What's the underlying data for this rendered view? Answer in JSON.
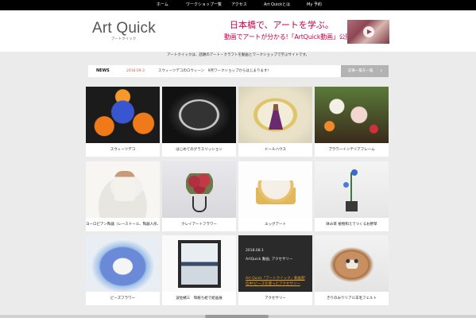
{
  "nav": {
    "items": [
      "ホーム",
      "ワークショップ一覧",
      "アクセス",
      "Art Quickとは",
      "My 予約"
    ]
  },
  "logo": {
    "title": "Art Quick",
    "subtitle": "アートクイック"
  },
  "banner": {
    "line1": "日本橋で、アートを学ぶ。",
    "line2": "動画でアートが分かる!「ArtQuick動画」公開中!"
  },
  "tagline": "アートクイックは、話題のアート・クラフトを動画とワークショップで学ぶサイトです。",
  "news": {
    "label": "NEWS",
    "date": "2018.09.3",
    "text": "スウィーツデコのロウィーン　9月ワークショップからはじまります！",
    "button": "記事一覧を一覧",
    "button_arrow": "›"
  },
  "cards": [
    {
      "caption": "スウィーツデコ"
    },
    {
      "caption": "はじめてのグラスリッション"
    },
    {
      "caption": "ドールハウス"
    },
    {
      "caption": "プラワーインテリアフレーム"
    },
    {
      "caption": "ヨーロピアン陶器（レースドール、陶器人形、陶"
    },
    {
      "caption": "クレイアートフラワー"
    },
    {
      "caption": "エッグアート"
    },
    {
      "caption": "鉢み草 植物和えでつくるお野草"
    },
    {
      "caption": "ビーズフラワー"
    },
    {
      "caption": "波佐緒三　和紙ち絵で絵画展"
    },
    {
      "caption": "アクセサリー"
    },
    {
      "caption": "きりのみりリアル羊毛フェルト"
    }
  ],
  "card11": {
    "date": "2018.08.1",
    "meta": "ArtQuick 動画, アクセサリー",
    "link": "Art Quick「アートクイック」動画配信中!ビーズを使ったアクセサリー"
  }
}
